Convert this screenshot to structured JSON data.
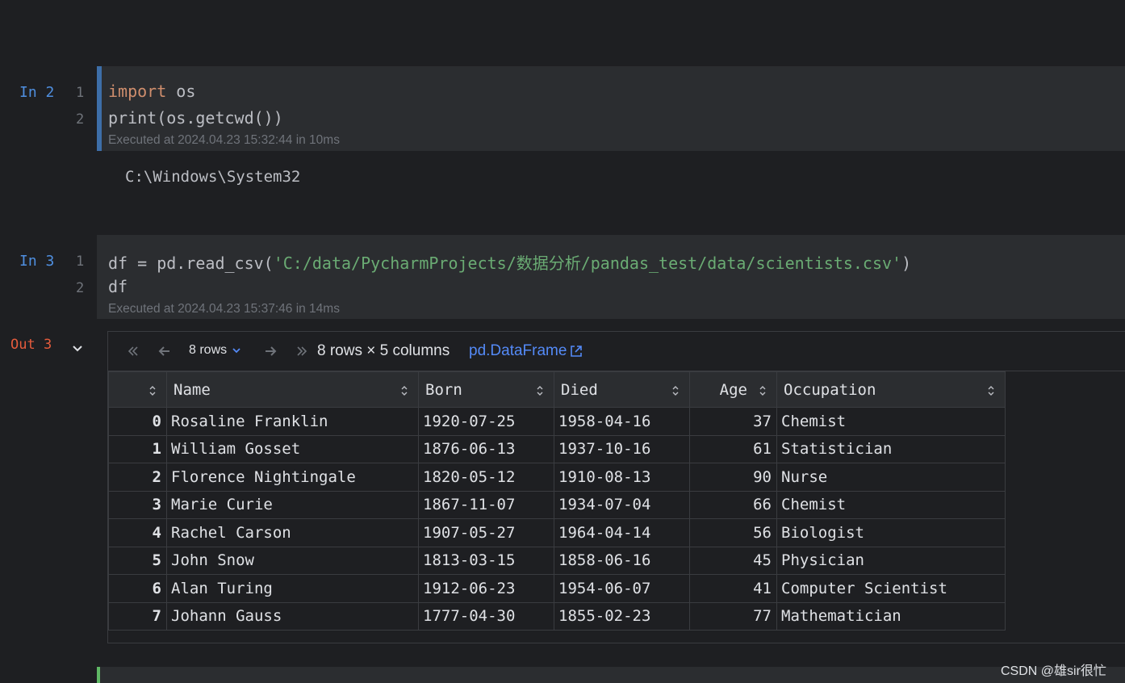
{
  "cells": [
    {
      "prompt": "In 2",
      "lines": [
        {
          "num": "1",
          "keyword": "import",
          "rest": " os"
        },
        {
          "num": "2",
          "text": "print(os.getcwd())"
        }
      ],
      "executed": "Executed at 2024.04.23 15:32:44 in 10ms",
      "output": "C:\\Windows\\System32"
    },
    {
      "prompt": "In 3",
      "lines": [
        {
          "num": "1",
          "prefix": "df = pd.read_csv(",
          "string": "'C:/data/PycharmProjects/数据分析/pandas_test/data/scientists.csv'",
          "suffix": ")"
        },
        {
          "num": "2",
          "text": "df"
        }
      ],
      "executed": "Executed at 2024.04.23 15:37:46 in 14ms"
    }
  ],
  "out": {
    "prompt": "Out 3",
    "toolbar": {
      "rows_label": "8 rows",
      "summary": "8 rows × 5 columns",
      "link": "pd.DataFrame"
    },
    "columns": [
      "",
      "Name",
      "Born",
      "Died",
      "Age",
      "Occupation"
    ],
    "rows": [
      [
        "0",
        "Rosaline Franklin",
        "1920-07-25",
        "1958-04-16",
        "37",
        "Chemist"
      ],
      [
        "1",
        "William Gosset",
        "1876-06-13",
        "1937-10-16",
        "61",
        "Statistician"
      ],
      [
        "2",
        "Florence Nightingale",
        "1820-05-12",
        "1910-08-13",
        "90",
        "Nurse"
      ],
      [
        "3",
        "Marie Curie",
        "1867-11-07",
        "1934-07-04",
        "66",
        "Chemist"
      ],
      [
        "4",
        "Rachel Carson",
        "1907-05-27",
        "1964-04-14",
        "56",
        "Biologist"
      ],
      [
        "5",
        "John Snow",
        "1813-03-15",
        "1858-06-16",
        "45",
        "Physician"
      ],
      [
        "6",
        "Alan Turing",
        "1912-06-23",
        "1954-06-07",
        "41",
        "Computer Scientist"
      ],
      [
        "7",
        "Johann Gauss",
        "1777-04-30",
        "1855-02-23",
        "77",
        "Mathematician"
      ]
    ]
  },
  "watermark": "CSDN @雄sir很忙",
  "colors": {
    "background": "#1e1f22",
    "cell_background": "#2b2d30",
    "keyword": "#cf8e6d",
    "string": "#6aab73",
    "prompt_in": "#4f8fe0",
    "prompt_out": "#e55b3c",
    "link": "#548af7",
    "active_cell_bar": "#3d6ea8",
    "new_cell_bar": "#5fb865"
  }
}
